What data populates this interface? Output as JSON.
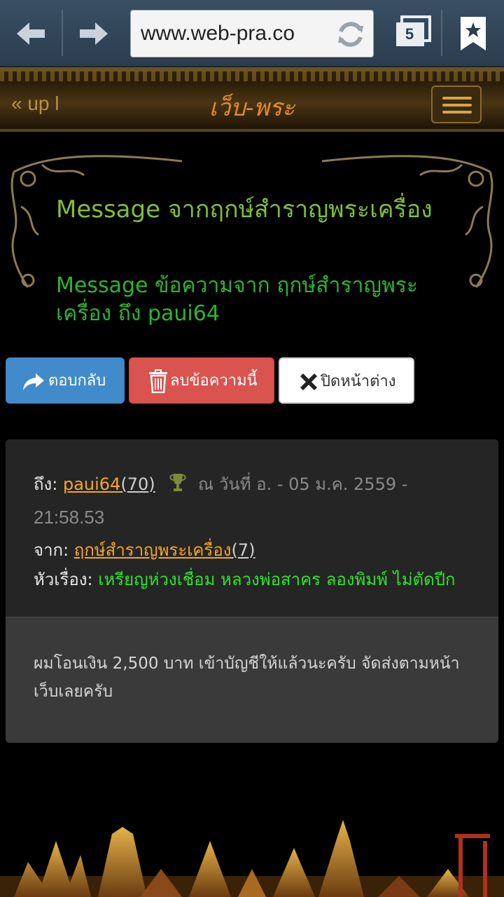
{
  "browser": {
    "url": "www.web-pra.co",
    "tab_count": "5"
  },
  "header": {
    "up_link": "« up l",
    "logo": "เว็บ-พระ"
  },
  "panel": {
    "title": "Message จากฤกษ์สำราญพระเครื่อง",
    "subtitle": "Message ข้อความจาก ฤกษ์สำราญพระเครื่อง ถึง paui64"
  },
  "buttons": {
    "reply": "ตอบกลับ",
    "delete": "ลบข้อความนี้",
    "close": "ปิดหน้าต่าง"
  },
  "message": {
    "to_label": "ถึง:",
    "to_user": "paui64",
    "to_score": "70",
    "date": "ณ วันที่ อ. - 05 ม.ค. 2559 -",
    "time": "21:58.53",
    "from_label": "จาก:",
    "from_user": "ฤกษ์สำราญพระเครื่อง",
    "from_score": "7",
    "subject_label": "หัวเรื่อง:",
    "subject": "เหรียญห่วงเชื่อม หลวงพ่อสาคร ลองพิมพ์ ไม่ตัดปีก",
    "body": "ผมโอนเงิน 2,500 บาท เข้าบัญชีให้แล้วนะครับ จัดส่งตามหน้าเว็บเลยครับ"
  },
  "colors": {
    "title": "#7fbf3a",
    "subtitle": "#2db52d",
    "reply_btn": "#428bca",
    "delete_btn": "#d9534f",
    "link": "#f5a623",
    "subject": "#2fe22f"
  }
}
